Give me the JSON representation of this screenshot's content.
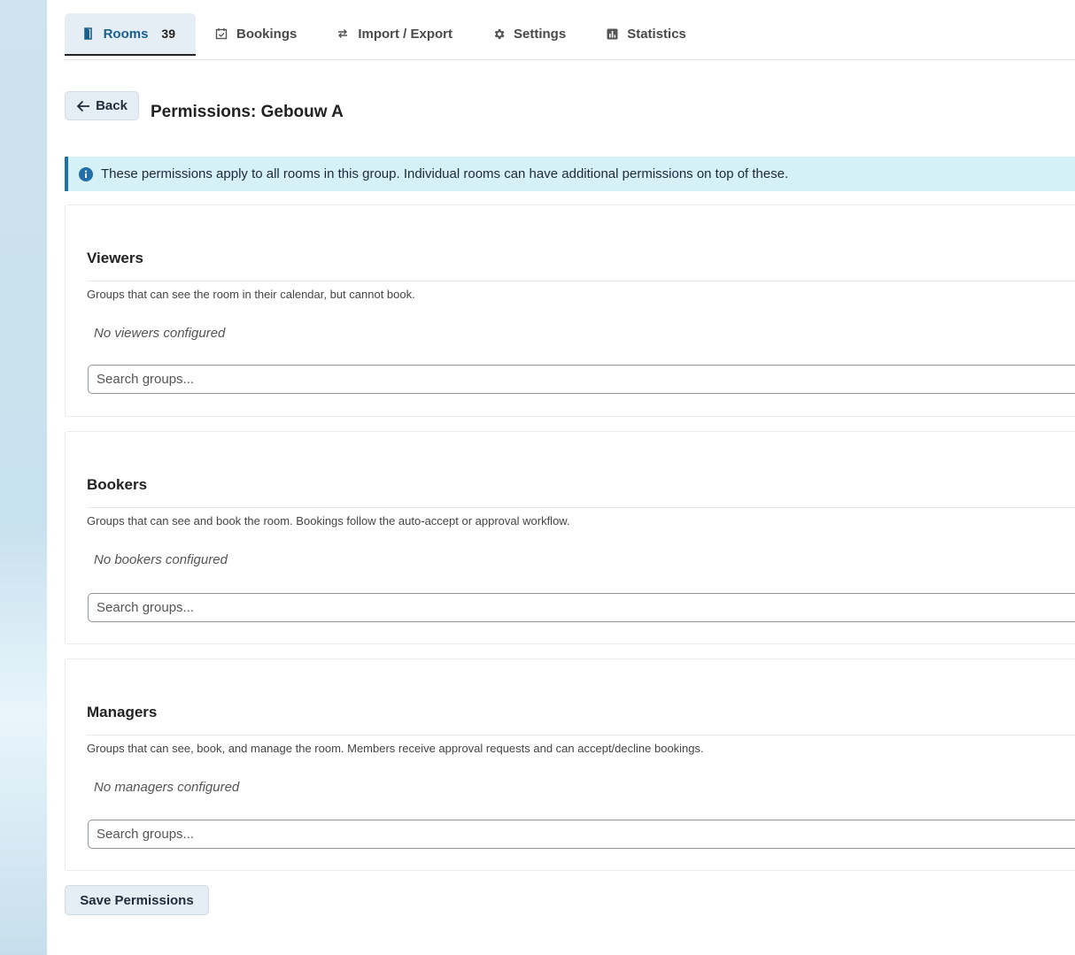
{
  "tabs": [
    {
      "label": "Rooms",
      "count": "39",
      "icon": "door-icon",
      "active": true
    },
    {
      "label": "Bookings",
      "icon": "calendar-check-icon"
    },
    {
      "label": "Import / Export",
      "icon": "arrows-swap-icon"
    },
    {
      "label": "Settings",
      "icon": "gear-icon"
    },
    {
      "label": "Statistics",
      "icon": "bar-chart-icon"
    }
  ],
  "header": {
    "back_label": "Back",
    "title": "Permissions: Gebouw A"
  },
  "info": {
    "text": "These permissions apply to all rooms in this group. Individual rooms can have additional permissions on top of these."
  },
  "sections": [
    {
      "title": "Viewers",
      "description": "Groups that can see the room in their calendar, but cannot book.",
      "empty": "No viewers configured",
      "search_placeholder": "Search groups..."
    },
    {
      "title": "Bookers",
      "description": "Groups that can see and book the room. Bookings follow the auto-accept or approval workflow.",
      "empty": "No bookers configured",
      "search_placeholder": "Search groups..."
    },
    {
      "title": "Managers",
      "description": "Groups that can see, book, and manage the room. Members receive approval requests and can accept/decline bookings.",
      "empty": "No managers configured",
      "search_placeholder": "Search groups..."
    }
  ],
  "actions": {
    "save_label": "Save Permissions"
  },
  "colors": {
    "accent": "#1a5f8c",
    "info_bg": "#d6f0f8",
    "info_border": "#1f6fa8",
    "button_bg": "#e6eef5"
  }
}
